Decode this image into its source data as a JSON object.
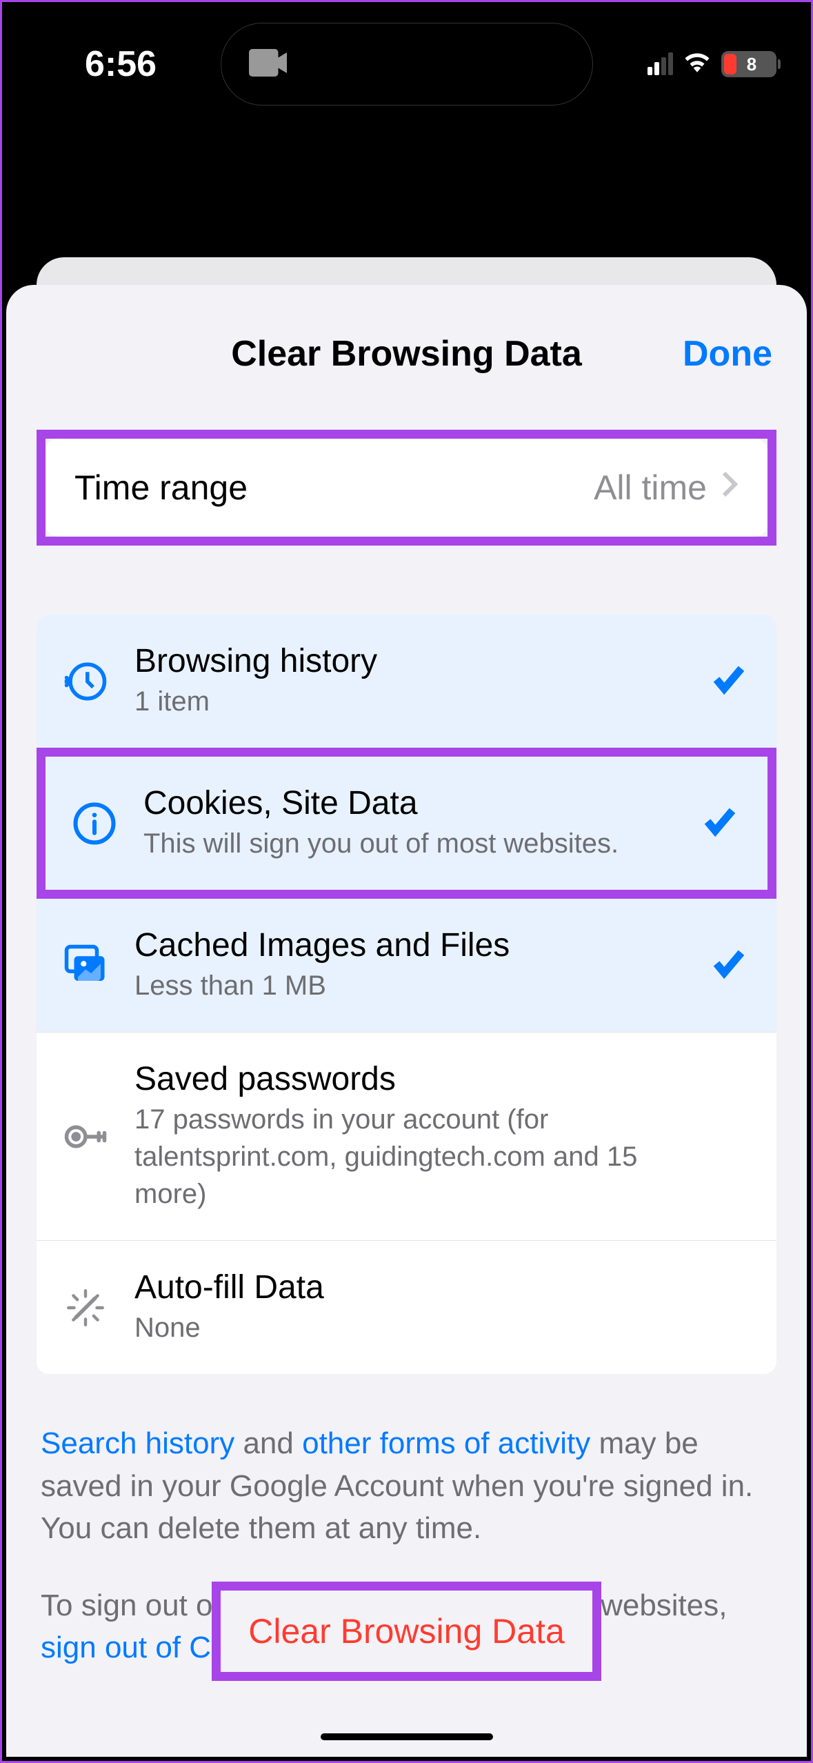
{
  "status": {
    "time": "6:56",
    "battery_percent": "8"
  },
  "sheet": {
    "title": "Clear Browsing Data",
    "done_label": "Done"
  },
  "time_range": {
    "label": "Time range",
    "value": "All time"
  },
  "items": {
    "history": {
      "title": "Browsing history",
      "subtitle": "1 item"
    },
    "cookies": {
      "title": "Cookies, Site Data",
      "subtitle": "This will sign you out of most websites."
    },
    "cache": {
      "title": "Cached Images and Files",
      "subtitle": "Less than 1 MB"
    },
    "passwords": {
      "title": "Saved passwords",
      "subtitle": "17 passwords in your account (for talentsprint.com, guidingtech.com and 15 more)"
    },
    "autofill": {
      "title": "Auto-fill Data",
      "subtitle": "None"
    }
  },
  "footer": {
    "link_search_history": "Search history",
    "text_and": " and ",
    "link_other_forms": "other forms of activity",
    "text_rest1": " may be saved in your Google Account when you're signed in. You can delete them at any time.",
    "text2_prefix": "To sign out of your Google Account on all websites, ",
    "link_sign_out": "sign out of Chrome",
    "text2_suffix": "."
  },
  "clear_button": "Clear Browsing Data"
}
